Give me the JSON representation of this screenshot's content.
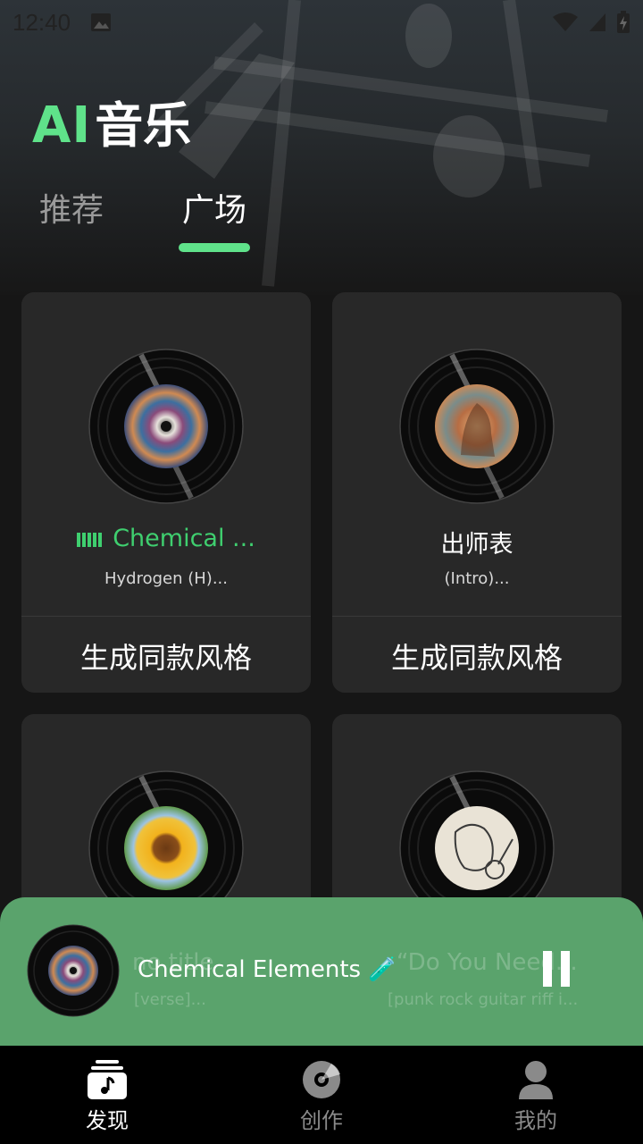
{
  "status": {
    "time": "12:40"
  },
  "header": {
    "logo_ai": "AI",
    "logo_text": "音乐"
  },
  "tabs": [
    {
      "label": "推荐"
    },
    {
      "label": "广场",
      "active": true
    }
  ],
  "cards": [
    {
      "title": "Chemical ...",
      "subtitle": "Hydrogen (H)...",
      "action": "生成同款风格",
      "playing": true
    },
    {
      "title": "出师表",
      "subtitle": "(Intro)...",
      "action": "生成同款风格",
      "playing": false
    },
    {
      "title": "no title",
      "subtitle": "[verse]..."
    },
    {
      "title": "“Do You Need...",
      "subtitle": "[punk rock guitar riff i..."
    }
  ],
  "player": {
    "title": "Chemical Elements 🧪",
    "state": "playing"
  },
  "nav": [
    {
      "label": "发现",
      "icon": "discover-icon",
      "active": true
    },
    {
      "label": "创作",
      "icon": "create-disc-icon"
    },
    {
      "label": "我的",
      "icon": "profile-icon"
    }
  ],
  "colors": {
    "accent": "#5fe28a",
    "player_bg": "#5aa36c",
    "card_bg": "#282828",
    "background": "#161616"
  }
}
